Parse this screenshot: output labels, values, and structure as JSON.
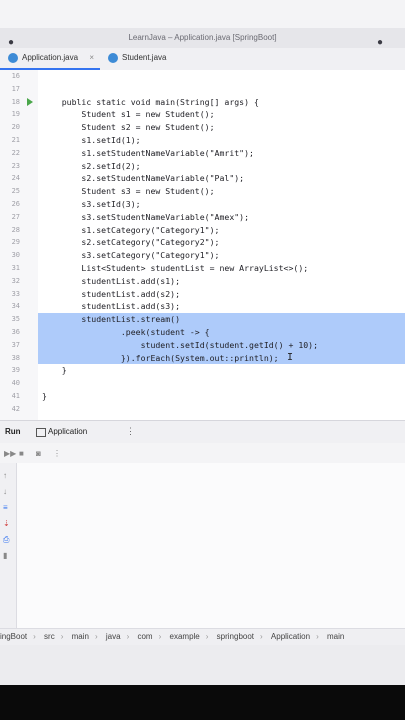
{
  "window": {
    "title": "LearnJava – Application.java [SpringBoot]"
  },
  "tabs": [
    {
      "label": "Application.java",
      "close": "×"
    },
    {
      "label": "Student.java"
    }
  ],
  "editor": {
    "lines": [
      {
        "num": "16",
        "code": ""
      },
      {
        "num": "17",
        "code": ""
      },
      {
        "num": "18",
        "code": "    public static void main(String[] args) {"
      },
      {
        "num": "19",
        "code": "        Student s1 = new Student();"
      },
      {
        "num": "20",
        "code": "        Student s2 = new Student();"
      },
      {
        "num": "21",
        "code": "        s1.setId(1);"
      },
      {
        "num": "22",
        "code": "        s1.setStudentNameVariable(\"Amrit\");"
      },
      {
        "num": "23",
        "code": "        s2.setId(2);"
      },
      {
        "num": "24",
        "code": "        s2.setStudentNameVariable(\"Pal\");"
      },
      {
        "num": "25",
        "code": "        Student s3 = new Student();"
      },
      {
        "num": "26",
        "code": "        s3.setId(3);"
      },
      {
        "num": "27",
        "code": "        s3.setStudentNameVariable(\"Amex\");"
      },
      {
        "num": "28",
        "code": "        s1.setCategory(\"Category1\");"
      },
      {
        "num": "29",
        "code": "        s2.setCategory(\"Category2\");"
      },
      {
        "num": "30",
        "code": "        s3.setCategory(\"Category1\");"
      },
      {
        "num": "31",
        "code": "        List<Student> studentList = new ArrayList<>();"
      },
      {
        "num": "32",
        "code": "        studentList.add(s1);"
      },
      {
        "num": "33",
        "code": "        studentList.add(s2);"
      },
      {
        "num": "34",
        "code": "        studentList.add(s3);"
      },
      {
        "num": "35",
        "code": "        studentList.stream()"
      },
      {
        "num": "36",
        "code": "                .peek(student -> {"
      },
      {
        "num": "37",
        "code": "                    student.setId(student.getId() + 10);"
      },
      {
        "num": "38",
        "code": "                }).forEach(System.out::println);"
      },
      {
        "num": "39",
        "code": "    }"
      },
      {
        "num": "40",
        "code": ""
      },
      {
        "num": "41",
        "code": "}"
      },
      {
        "num": "42",
        "code": ""
      }
    ]
  },
  "run_panel": {
    "label": "Run",
    "tab": "Application"
  },
  "breadcrumbs": [
    "ingBoot",
    "src",
    "main",
    "java",
    "com",
    "example",
    "springboot",
    "Application",
    "main"
  ],
  "colors": {
    "selection": "#aecbfa",
    "accent": "#3574f0",
    "run": "#4aa64a"
  }
}
